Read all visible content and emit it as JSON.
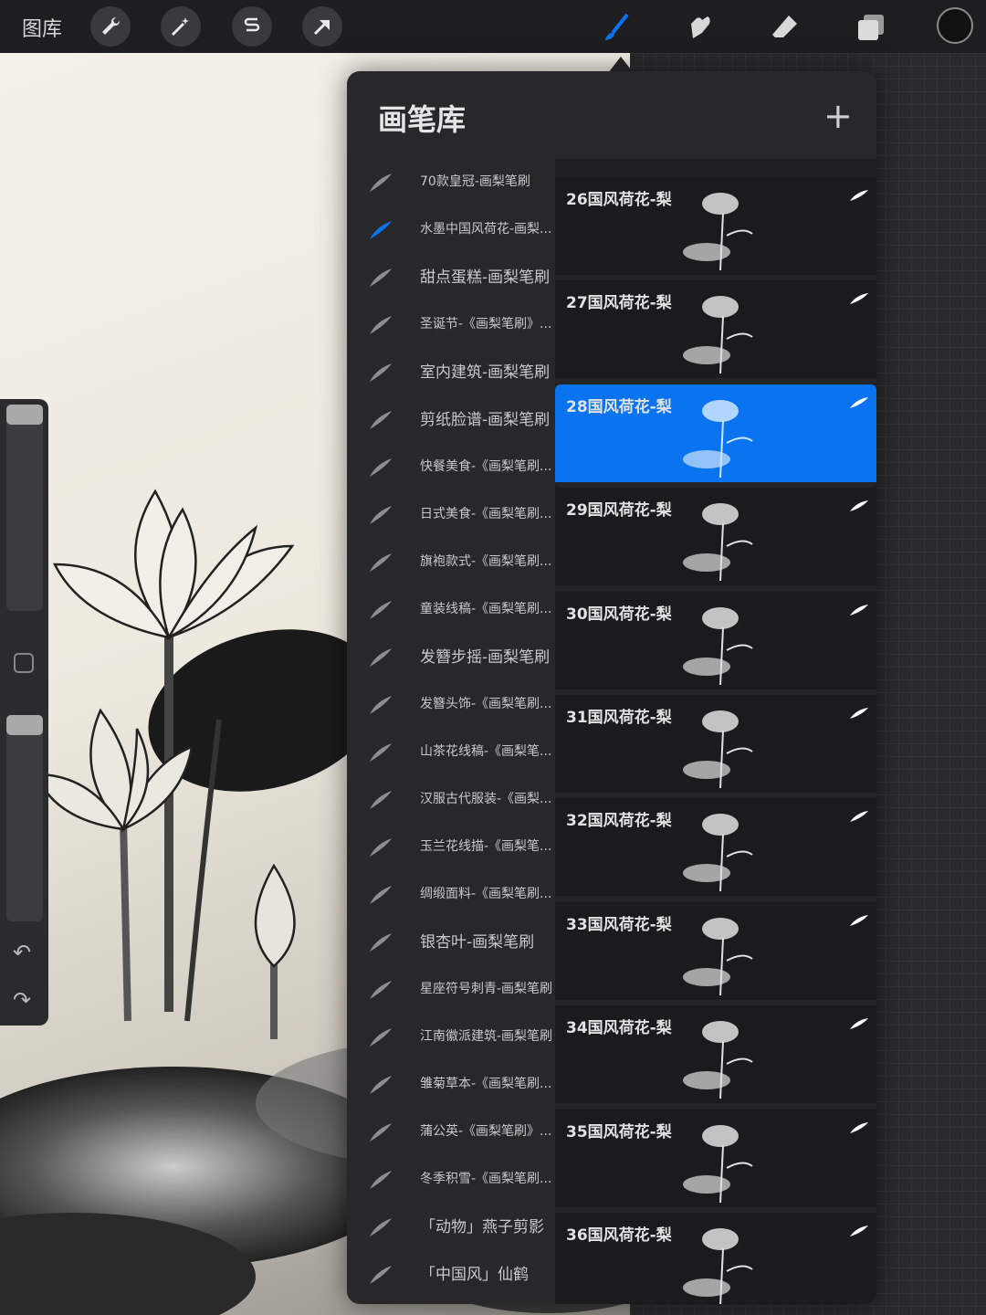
{
  "topbar": {
    "gallery_label": "图库",
    "left_tools": [
      "wrench-icon",
      "magic-wand-icon",
      "selection-s-icon",
      "arrow-transform-icon"
    ],
    "right_tools": [
      "brush-icon",
      "smudge-icon",
      "eraser-icon",
      "layers-icon"
    ],
    "active_tool": "brush-icon",
    "active_color": "#0a74f0",
    "current_color": "#111111"
  },
  "panel": {
    "title": "画笔库",
    "add_label": "+",
    "brush_sets": [
      {
        "label": "70款皇冠-画梨笔刷",
        "big": false,
        "active": false
      },
      {
        "label": "水墨中国风荷花-画梨...",
        "big": false,
        "active": true
      },
      {
        "label": "甜点蛋糕-画梨笔刷",
        "big": true,
        "active": false
      },
      {
        "label": "圣诞节-《画梨笔刷》...",
        "big": false,
        "active": false
      },
      {
        "label": "室内建筑-画梨笔刷",
        "big": true,
        "active": false
      },
      {
        "label": "剪纸脸谱-画梨笔刷",
        "big": true,
        "active": false
      },
      {
        "label": "快餐美食-《画梨笔刷...",
        "big": false,
        "active": false
      },
      {
        "label": "日式美食-《画梨笔刷...",
        "big": false,
        "active": false
      },
      {
        "label": "旗袍款式-《画梨笔刷...",
        "big": false,
        "active": false
      },
      {
        "label": "童装线稿-《画梨笔刷...",
        "big": false,
        "active": false
      },
      {
        "label": "发簪步摇-画梨笔刷",
        "big": true,
        "active": false
      },
      {
        "label": "发簪头饰-《画梨笔刷...",
        "big": false,
        "active": false
      },
      {
        "label": "山茶花线稿-《画梨笔...",
        "big": false,
        "active": false
      },
      {
        "label": "汉服古代服装-《画梨...",
        "big": false,
        "active": false
      },
      {
        "label": "玉兰花线描-《画梨笔...",
        "big": false,
        "active": false
      },
      {
        "label": "绸缎面料-《画梨笔刷...",
        "big": false,
        "active": false
      },
      {
        "label": "银杏叶-画梨笔刷",
        "big": true,
        "active": false
      },
      {
        "label": "星座符号刺青-画梨笔刷",
        "big": false,
        "active": false
      },
      {
        "label": "江南徽派建筑-画梨笔刷",
        "big": false,
        "active": false
      },
      {
        "label": "雏菊草本-《画梨笔刷...",
        "big": false,
        "active": false
      },
      {
        "label": "蒲公英-《画梨笔刷》...",
        "big": false,
        "active": false
      },
      {
        "label": "冬季积雪-《画梨笔刷...",
        "big": false,
        "active": false
      },
      {
        "label": "「动物」燕子剪影",
        "big": true,
        "active": false
      },
      {
        "label": "「中国风」仙鹤",
        "big": true,
        "active": false
      }
    ],
    "brushes": [
      {
        "name": "26国风荷花-梨",
        "selected": false
      },
      {
        "name": "27国风荷花-梨",
        "selected": false
      },
      {
        "name": "28国风荷花-梨",
        "selected": true
      },
      {
        "name": "29国风荷花-梨",
        "selected": false
      },
      {
        "name": "30国风荷花-梨",
        "selected": false
      },
      {
        "name": "31国风荷花-梨",
        "selected": false
      },
      {
        "name": "32国风荷花-梨",
        "selected": false
      },
      {
        "name": "33国风荷花-梨",
        "selected": false
      },
      {
        "name": "34国风荷花-梨",
        "selected": false
      },
      {
        "name": "35国风荷花-梨",
        "selected": false
      },
      {
        "name": "36国风荷花-梨",
        "selected": false
      }
    ]
  },
  "sidebar": {
    "brush_size_icon": "size-slider",
    "modifier_icon": "square-modifier-icon",
    "opacity_icon": "opacity-slider",
    "undo_icon": "undo-icon",
    "redo_icon": "redo-icon"
  }
}
